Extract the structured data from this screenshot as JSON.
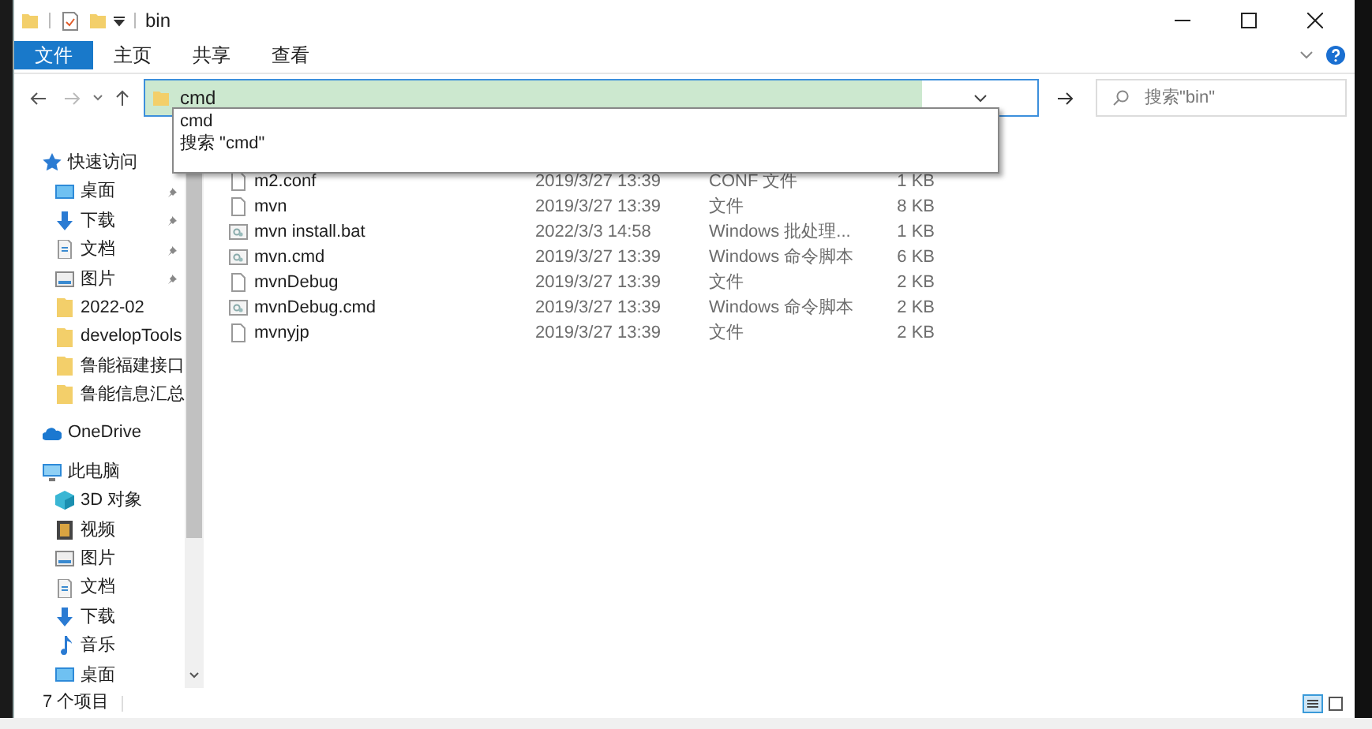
{
  "window": {
    "title": "bin"
  },
  "ribbon_tabs": [
    {
      "label": "文件",
      "selected": true
    },
    {
      "label": "主页",
      "selected": false
    },
    {
      "label": "共享",
      "selected": false
    },
    {
      "label": "查看",
      "selected": false
    }
  ],
  "address_bar": {
    "value": "cmd"
  },
  "autocomplete": [
    "cmd",
    "搜索 \"cmd\""
  ],
  "search": {
    "placeholder": "搜索\"bin\""
  },
  "sidebar": [
    {
      "label": "快速访问",
      "kind": "star",
      "children": [
        {
          "label": "桌面",
          "kind": "desktop",
          "pinned": true
        },
        {
          "label": "下载",
          "kind": "download",
          "pinned": true
        },
        {
          "label": "文档",
          "kind": "document",
          "pinned": true
        },
        {
          "label": "图片",
          "kind": "picture",
          "pinned": true
        },
        {
          "label": "2022-02",
          "kind": "folder",
          "pinned": false
        },
        {
          "label": "developTools",
          "kind": "folder",
          "pinned": false
        },
        {
          "label": "鲁能福建接口",
          "kind": "folder",
          "pinned": false
        },
        {
          "label": "鲁能信息汇总",
          "kind": "folder",
          "pinned": false
        }
      ]
    },
    {
      "label": "OneDrive",
      "kind": "cloud"
    },
    {
      "label": "此电脑",
      "kind": "pc",
      "children": [
        {
          "label": "3D 对象",
          "kind": "cube"
        },
        {
          "label": "视频",
          "kind": "video"
        },
        {
          "label": "图片",
          "kind": "picture"
        },
        {
          "label": "文档",
          "kind": "document"
        },
        {
          "label": "下载",
          "kind": "download"
        },
        {
          "label": "音乐",
          "kind": "music"
        },
        {
          "label": "桌面",
          "kind": "desktop"
        }
      ]
    }
  ],
  "files": [
    {
      "name": "m2.conf",
      "kind": "file",
      "modified": "2019/3/27 13:39",
      "type": "CONF 文件",
      "size": "1 KB"
    },
    {
      "name": "mvn",
      "kind": "file",
      "modified": "2019/3/27 13:39",
      "type": "文件",
      "size": "8 KB"
    },
    {
      "name": "mvn install.bat",
      "kind": "script",
      "modified": "2022/3/3 14:58",
      "type": "Windows 批处理...",
      "size": "1 KB"
    },
    {
      "name": "mvn.cmd",
      "kind": "script",
      "modified": "2019/3/27 13:39",
      "type": "Windows 命令脚本",
      "size": "6 KB"
    },
    {
      "name": "mvnDebug",
      "kind": "file",
      "modified": "2019/3/27 13:39",
      "type": "文件",
      "size": "2 KB"
    },
    {
      "name": "mvnDebug.cmd",
      "kind": "script",
      "modified": "2019/3/27 13:39",
      "type": "Windows 命令脚本",
      "size": "2 KB"
    },
    {
      "name": "mvnyjp",
      "kind": "file",
      "modified": "2019/3/27 13:39",
      "type": "文件",
      "size": "2 KB"
    }
  ],
  "status_bar": {
    "item_count": "7 个项目"
  }
}
